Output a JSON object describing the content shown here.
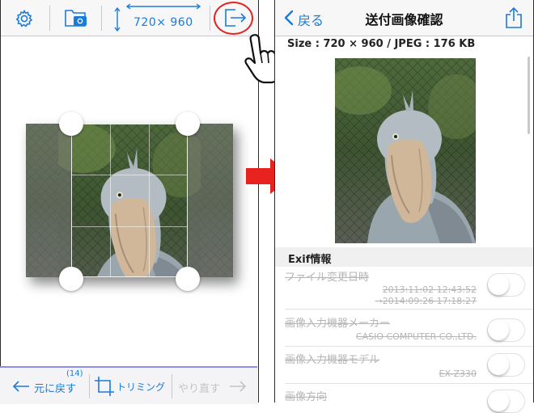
{
  "left_screen": {
    "toolbar": {
      "settings_icon": "gear-icon",
      "camera_roll_icon": "folder-camera-icon",
      "size_text": "720× 960",
      "share_icon": "export-arrow-icon"
    },
    "bottom_bar": {
      "undo_count": "(14)",
      "undo_label": "元に戻す",
      "trim_label": "トリミング",
      "redo_label": "やり直す"
    }
  },
  "right_screen": {
    "nav": {
      "back_label": "戻る",
      "title": "送付画像確認",
      "share_icon": "share-icon"
    },
    "size_info": "Size : 720 × 960 / JPEG : 176 KB",
    "exif": {
      "section_title": "Exif情報",
      "rows": [
        {
          "title": "ファイル変更日時",
          "value1": "2013:11:02 12:43:52",
          "value2": "→2014:09:26 17:18:27"
        },
        {
          "title": "画像入力機器メーカー",
          "value1": "CASIO COMPUTER CO.,LTD."
        },
        {
          "title": "画像入力機器モデル",
          "value1": "EX-Z330"
        },
        {
          "title": "画像方向"
        }
      ]
    }
  },
  "colors": {
    "accent": "#1a7bd8",
    "highlight": "#e8231f",
    "arrow": "#e8231f"
  }
}
